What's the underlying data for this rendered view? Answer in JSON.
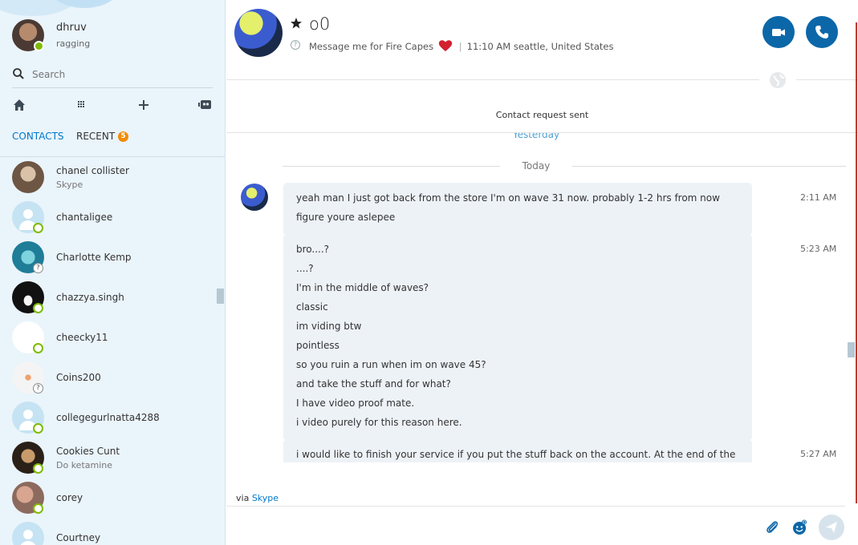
{
  "me": {
    "name": "dhruv",
    "mood": "ragging"
  },
  "search": {
    "placeholder": "Search"
  },
  "toolbar": {
    "icons": [
      "home-icon",
      "dialpad-icon",
      "add-icon",
      "bot-icon"
    ]
  },
  "tabs": {
    "contacts": "CONTACTS",
    "recent": "RECENT",
    "recent_badge": "5"
  },
  "contacts": [
    {
      "name": "chanel collister",
      "sub": "Skype",
      "presence": "none"
    },
    {
      "name": "chantaligee",
      "sub": "",
      "presence": "online"
    },
    {
      "name": "Charlotte Kemp",
      "sub": "",
      "presence": "unknown"
    },
    {
      "name": "chazzya.singh",
      "sub": "",
      "presence": "online"
    },
    {
      "name": "cheecky11",
      "sub": "",
      "presence": "online"
    },
    {
      "name": "Coins200",
      "sub": "",
      "presence": "unknown"
    },
    {
      "name": "collegegurlnatta4288",
      "sub": "",
      "presence": "online"
    },
    {
      "name": "Cookies Cunt",
      "sub": "Do ketamine",
      "presence": "online"
    },
    {
      "name": "corey",
      "sub": "",
      "presence": "online"
    },
    {
      "name": "Courtney",
      "sub": "",
      "presence": "online"
    }
  ],
  "chat": {
    "title": "o0",
    "mood_text": "Message me for Fire Capes",
    "location": "11:10 AM seattle, United States",
    "request_status": "Contact request sent",
    "yesterday_label": "Yesterday",
    "today_label": "Today",
    "messages": [
      {
        "time": "2:11 AM",
        "lines": [
          "yeah man I just got back from the store I'm on wave 31 now. probably 1-2 hrs from now",
          "figure youre aslepee"
        ]
      },
      {
        "time": "5:23 AM",
        "lines": [
          "bro....?",
          "....?",
          "I'm in the middle of waves?",
          "classic",
          "im viding btw",
          "pointless",
          "so you ruin a run when im on wave 45?",
          "and take the stuff and for what?",
          "I have video proof mate.",
          "i video purely for this reason here."
        ]
      },
      {
        "time": "5:27 AM",
        "lines": [
          "i would like to finish your service if you put the stuff back on the account. At the end of the"
        ]
      }
    ]
  },
  "footer": {
    "via_prefix": "via",
    "via_link": "Skype"
  },
  "colors": {
    "accent": "#0078ca",
    "call_button": "#0b67a8",
    "online": "#7fba00",
    "badge": "#f28b00",
    "sidebar_bg": "#eaf4fb",
    "bubble_bg": "#edf2f7"
  }
}
